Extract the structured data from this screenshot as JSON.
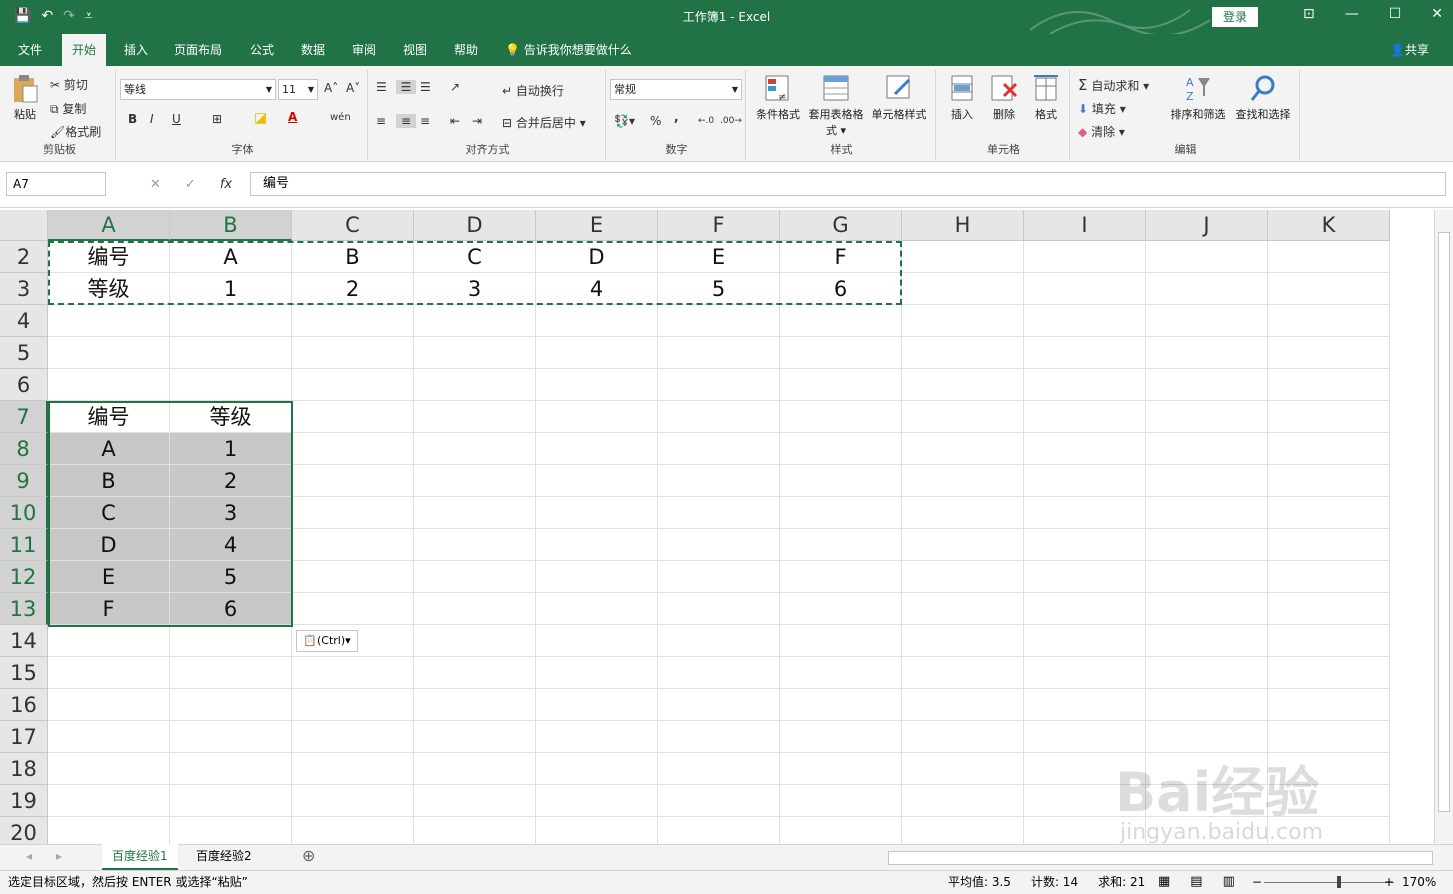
{
  "titlebar": {
    "title": "工作簿1  -  Excel",
    "login": "登录",
    "save": "💾",
    "undo": "↶",
    "redo": "↷",
    "qat_more": "⩡",
    "restore": "▭",
    "minimize": "—",
    "maximize": "☐",
    "close": "✕",
    "ribbon_display": "⊡"
  },
  "menu": {
    "tabs": [
      "文件",
      "开始",
      "插入",
      "页面布局",
      "公式",
      "数据",
      "审阅",
      "视图",
      "帮助"
    ],
    "tellme": "告诉我你想要做什么",
    "share": "共享",
    "lightbulb": "💡",
    "person": "👤"
  },
  "ribbon": {
    "clipboard": {
      "paste": "粘贴",
      "cut": "剪切",
      "copy": "复制",
      "painter": "格式刷",
      "label": "剪贴板"
    },
    "font": {
      "name": "等线",
      "size": "11",
      "bold": "B",
      "italic": "I",
      "underline": "U",
      "grow": "A˄",
      "shrink": "A˅",
      "label": "字体",
      "phonetic": "wén"
    },
    "align": {
      "wrap": "自动换行",
      "merge": "合并后居中",
      "label": "对齐方式"
    },
    "number": {
      "format": "常规",
      "percent": "%",
      "comma": ",",
      "inc": "←.0",
      "dec": ".00→",
      "label": "数字"
    },
    "styles": {
      "cond": "条件格式",
      "table": "套用表格格式",
      "cell": "单元格样式",
      "label": "样式"
    },
    "cells": {
      "insert": "插入",
      "delete": "删除",
      "format": "格式",
      "label": "单元格"
    },
    "editing": {
      "autosum": "自动求和",
      "fill": "填充",
      "clear": "清除",
      "sort": "排序和筛选",
      "find": "查找和选择",
      "label": "编辑",
      "sigma": "Σ"
    }
  },
  "formula_bar": {
    "name_box": "A7",
    "cancel": "✕",
    "enter": "✓",
    "fx": "fx",
    "value": "编号"
  },
  "columns": [
    "A",
    "B",
    "C",
    "D",
    "E",
    "F",
    "G",
    "H",
    "I",
    "J",
    "K"
  ],
  "rows": [
    {
      "n": "2",
      "cells": [
        "编号",
        "A",
        "B",
        "C",
        "D",
        "E",
        "F",
        "",
        "",
        "",
        ""
      ]
    },
    {
      "n": "3",
      "cells": [
        "等级",
        "1",
        "2",
        "3",
        "4",
        "5",
        "6",
        "",
        "",
        "",
        ""
      ]
    },
    {
      "n": "4",
      "cells": [
        "",
        "",
        "",
        "",
        "",
        "",
        "",
        "",
        "",
        "",
        ""
      ]
    },
    {
      "n": "5",
      "cells": [
        "",
        "",
        "",
        "",
        "",
        "",
        "",
        "",
        "",
        "",
        ""
      ]
    },
    {
      "n": "6",
      "cells": [
        "",
        "",
        "",
        "",
        "",
        "",
        "",
        "",
        "",
        "",
        ""
      ]
    },
    {
      "n": "7",
      "cells": [
        "编号",
        "等级",
        "",
        "",
        "",
        "",
        "",
        "",
        "",
        "",
        ""
      ]
    },
    {
      "n": "8",
      "cells": [
        "A",
        "1",
        "",
        "",
        "",
        "",
        "",
        "",
        "",
        "",
        ""
      ]
    },
    {
      "n": "9",
      "cells": [
        "B",
        "2",
        "",
        "",
        "",
        "",
        "",
        "",
        "",
        "",
        ""
      ]
    },
    {
      "n": "10",
      "cells": [
        "C",
        "3",
        "",
        "",
        "",
        "",
        "",
        "",
        "",
        "",
        ""
      ]
    },
    {
      "n": "11",
      "cells": [
        "D",
        "4",
        "",
        "",
        "",
        "",
        "",
        "",
        "",
        "",
        ""
      ]
    },
    {
      "n": "12",
      "cells": [
        "E",
        "5",
        "",
        "",
        "",
        "",
        "",
        "",
        "",
        "",
        ""
      ]
    },
    {
      "n": "13",
      "cells": [
        "F",
        "6",
        "",
        "",
        "",
        "",
        "",
        "",
        "",
        "",
        ""
      ]
    },
    {
      "n": "14",
      "cells": [
        "",
        "",
        "",
        "",
        "",
        "",
        "",
        "",
        "",
        "",
        ""
      ]
    },
    {
      "n": "15",
      "cells": [
        "",
        "",
        "",
        "",
        "",
        "",
        "",
        "",
        "",
        "",
        ""
      ]
    },
    {
      "n": "16",
      "cells": [
        "",
        "",
        "",
        "",
        "",
        "",
        "",
        "",
        "",
        "",
        ""
      ]
    },
    {
      "n": "17",
      "cells": [
        "",
        "",
        "",
        "",
        "",
        "",
        "",
        "",
        "",
        "",
        ""
      ]
    },
    {
      "n": "18",
      "cells": [
        "",
        "",
        "",
        "",
        "",
        "",
        "",
        "",
        "",
        "",
        ""
      ]
    },
    {
      "n": "19",
      "cells": [
        "",
        "",
        "",
        "",
        "",
        "",
        "",
        "",
        "",
        "",
        ""
      ]
    },
    {
      "n": "20",
      "cells": [
        "",
        "",
        "",
        "",
        "",
        "",
        "",
        "",
        "",
        "",
        ""
      ]
    }
  ],
  "paste_options": "(Ctrl)▾",
  "sheets": {
    "tabs": [
      "百度经验1",
      "百度经验2"
    ],
    "add": "⊕",
    "nav_prev": "◂",
    "nav_next": "▸"
  },
  "status": {
    "message": "选定目标区域，然后按 ENTER 或选择“粘贴”",
    "average": "平均值: 3.5",
    "count": "计数: 14",
    "sum": "求和: 21",
    "zoom": "170%",
    "zoom_minus": "−",
    "zoom_plus": "+",
    "view_normal": "▦",
    "view_layout": "▤",
    "view_break": "▥"
  },
  "watermark": {
    "main": "Bai经验",
    "sub": "jingyan.baidu.com"
  },
  "colors": {
    "accent": "#217346"
  }
}
